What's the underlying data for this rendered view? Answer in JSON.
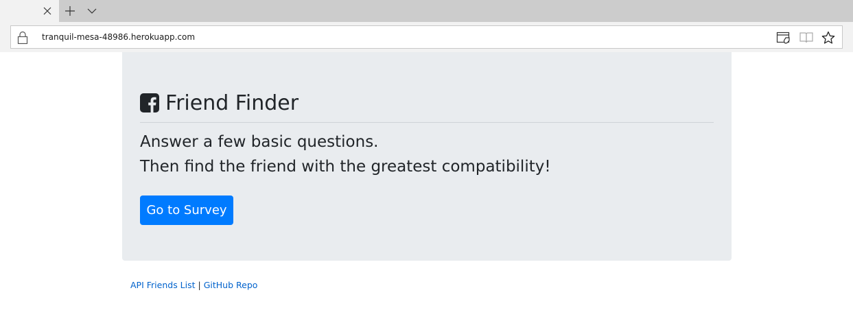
{
  "browser": {
    "url": "tranquil-mesa-48986.herokuapp.com",
    "icons": {
      "tab_close": "close-icon",
      "new_tab": "plus-icon",
      "tab_list": "chevron-down-icon",
      "lock": "lock-icon",
      "permissions": "site-permissions-icon",
      "reading_view": "book-icon",
      "favorite": "star-icon"
    }
  },
  "hero": {
    "title": "Friend Finder",
    "lead_line1": "Answer a few basic questions.",
    "lead_line2": "Then find the friend with the greatest compatibility!",
    "button_label": "Go to Survey"
  },
  "footer": {
    "link1": "API Friends List",
    "separator": "|",
    "link2": "GitHub Repo"
  },
  "colors": {
    "primary": "#007bff",
    "jumbotron_bg": "#e9ecef",
    "link": "#0062cc"
  }
}
